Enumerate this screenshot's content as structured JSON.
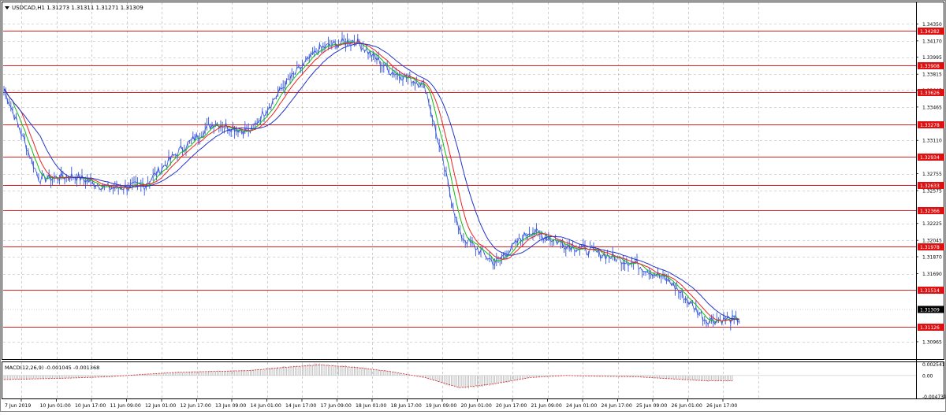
{
  "symbol_header": {
    "title": "USDCAD,H1  1.31273 1.31311 1.31271 1.31309",
    "menu_icon": "triangle-down-icon"
  },
  "macd_header": {
    "title": "MACD(12,26,9) -0.001045 -0.001368"
  },
  "colors": {
    "price": "#3355dd",
    "ma_fast": "#11bb11",
    "ma_mid": "#ee2222",
    "ma_slow": "#2233cc",
    "level_line": "#dd2222",
    "level_label_bg": "#dd1111",
    "grid": "#b0b0b0",
    "macd_hist": "#b8b8b8",
    "macd_signal": "#dd2222"
  },
  "chart_data": [
    {
      "type": "line",
      "title": "USDCAD,H1",
      "price_scale_ticks": [
        "1.34350",
        "1.34170",
        "1.33995",
        "1.33815",
        "1.33645",
        "1.33465",
        "1.33110",
        "1.32755",
        "1.32575",
        "1.32225",
        "1.32045",
        "1.31870",
        "1.31690",
        "1.30965"
      ],
      "ylim": [
        1.3078,
        1.3458
      ],
      "current_price": "1.31309",
      "horizontal_levels": [
        "1.34282",
        "1.33908",
        "1.33626",
        "1.33278",
        "1.32934",
        "1.32633",
        "1.32366",
        "1.31978",
        "1.31514",
        "1.31126"
      ],
      "time_labels": [
        "7 Jun 2019",
        "10 Jun 01:00",
        "10 Jun 17:00",
        "11 Jun 09:00",
        "12 Jun 01:00",
        "12 Jun 17:00",
        "13 Jun 09:00",
        "14 Jun 01:00",
        "14 Jun 17:00",
        "17 Jun 09:00",
        "18 Jun 01:00",
        "18 Jun 17:00",
        "19 Jun 09:00",
        "20 Jun 01:00",
        "20 Jun 17:00",
        "21 Jun 09:00",
        "24 Jun 01:00",
        "24 Jun 17:00",
        "25 Jun 09:00",
        "26 Jun 01:00",
        "26 Jun 17:00"
      ],
      "price_path": {
        "name": "USDCAD",
        "t": [
          0,
          1,
          2,
          3,
          4,
          5,
          6,
          7,
          8,
          9,
          10,
          11,
          12,
          13,
          14,
          15,
          16,
          17,
          18,
          19,
          20
        ],
        "values": [
          1.3366,
          1.327,
          1.3273,
          1.326,
          1.3263,
          1.33,
          1.333,
          1.332,
          1.337,
          1.3409,
          1.3418,
          1.3385,
          1.337,
          1.321,
          1.318,
          1.3215,
          1.32,
          1.319,
          1.318,
          1.316,
          1.312
        ]
      },
      "moving_averages": [
        "ma_fast",
        "ma_mid",
        "ma_slow"
      ]
    },
    {
      "type": "bar",
      "title": "MACD(12,26,9)",
      "price_scale_ticks": [
        "0.002541",
        "0.00",
        "-0.004731"
      ],
      "ylim": [
        -0.0052,
        0.003
      ],
      "macd_main": -0.001045,
      "macd_signal": -0.001368,
      "signal_path": {
        "t": [
          0,
          2,
          3,
          4,
          5,
          6,
          7,
          8,
          9,
          10,
          11,
          12,
          13,
          14,
          15,
          16,
          17,
          18,
          19,
          20
        ],
        "values": [
          -0.001,
          -0.0006,
          -0.0003,
          0.0003,
          0.0008,
          0.001,
          0.0012,
          0.002,
          0.0026,
          0.002,
          0.001,
          -0.0005,
          -0.003,
          -0.002,
          -0.0005,
          0.0,
          -0.0002,
          -0.0003,
          -0.0008,
          -0.0013
        ]
      }
    }
  ]
}
